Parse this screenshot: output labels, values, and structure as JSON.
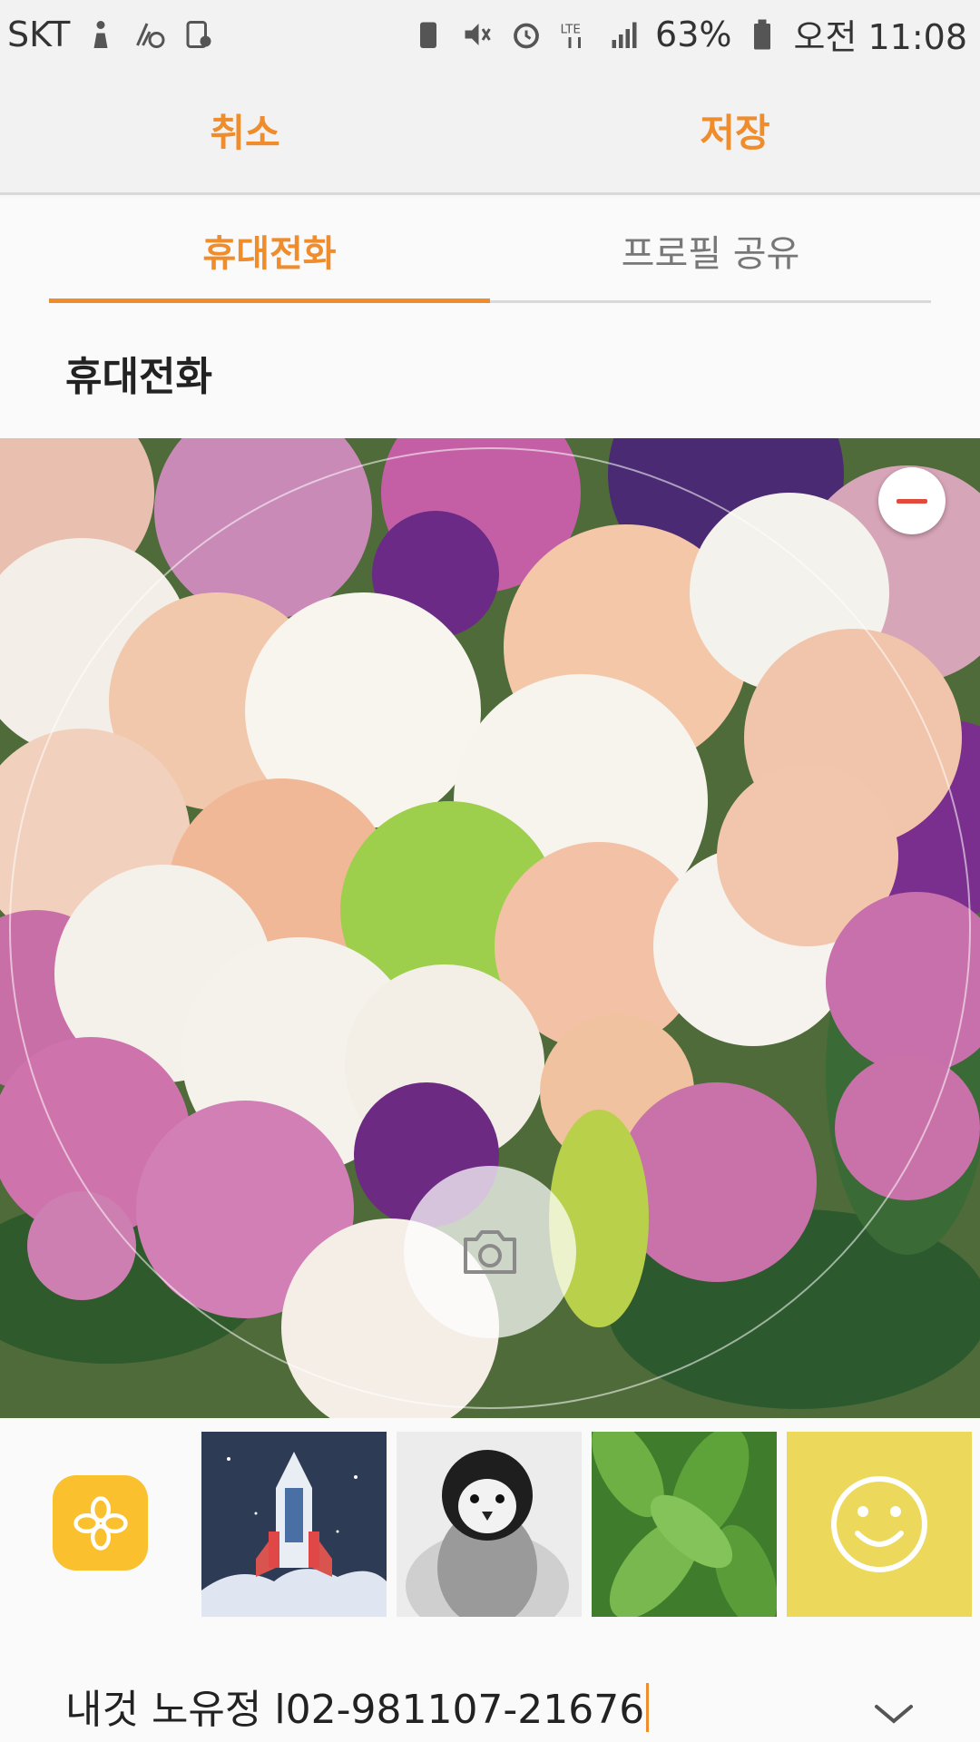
{
  "status_bar": {
    "carrier": "SKT",
    "battery": "63%",
    "time": "오전 11:08",
    "network": "LTE",
    "icons": [
      "silhouette-icon",
      "wifi-call-icon",
      "phone-icon",
      "battery-save-icon",
      "mute-icon",
      "alarm-icon",
      "lte-icon",
      "signal-icon",
      "battery-icon"
    ]
  },
  "action_bar": {
    "cancel": "취소",
    "save": "저장"
  },
  "tabs": [
    {
      "label": "휴대전화",
      "selected": true
    },
    {
      "label": "프로필 공유",
      "selected": false
    }
  ],
  "section": {
    "title": "휴대전화"
  },
  "photo": {
    "content": "flower-bouquet-photo",
    "remove_icon": "minus-icon",
    "camera_icon": "camera-icon"
  },
  "picker": {
    "gallery_icon": "gallery-app-icon",
    "thumbnails": [
      "rocket-image",
      "penguin-image",
      "leaves-image",
      "smiley-image"
    ]
  },
  "name_field": {
    "value": "내것 노유정 l02-981107-21676",
    "expand_icon": "chevron-down-icon"
  },
  "colors": {
    "accent": "#ef8c2c",
    "remove": "#e24a3b",
    "gallery": "#fbc02d"
  }
}
